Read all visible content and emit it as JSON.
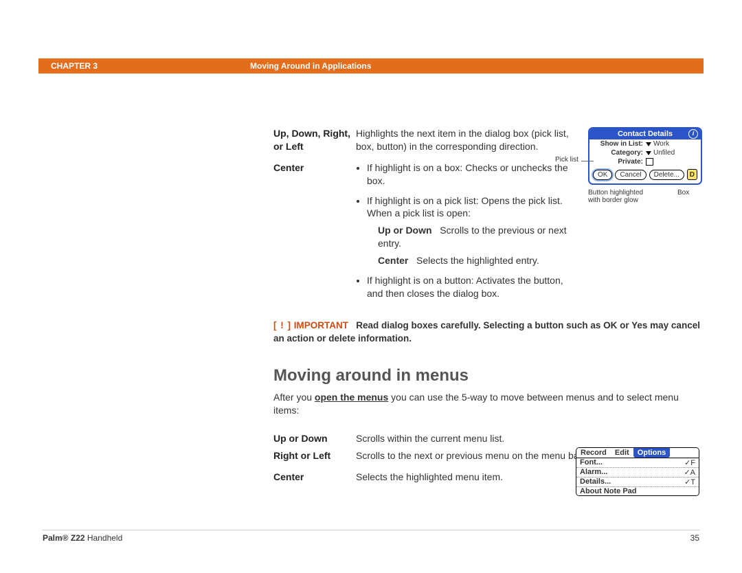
{
  "header": {
    "chapter": "CHAPTER 3",
    "section": "Moving Around in Applications"
  },
  "dialog_table": [
    {
      "label": "Up, Down, Right, or Left",
      "desc": "Highlights the next item in the dialog box (pick list, box, button) in the corresponding direction."
    }
  ],
  "center": {
    "label": "Center",
    "bullet1": "If highlight is on a box: Checks or unchecks the box.",
    "bullet2": "If highlight is on a pick list: Opens the pick list. When a pick list is open:",
    "sub1_label": "Up or Down",
    "sub1_text": "Scrolls to the previous or next entry.",
    "sub2_label": "Center",
    "sub2_text": "Selects the highlighted entry.",
    "bullet3": "If highlight is on a button: Activates the button, and then closes the dialog box."
  },
  "important": {
    "bracket": "[ ! ]",
    "word": "IMPORTANT",
    "text": "Read dialog boxes carefully. Selecting a button such as OK or Yes may cancel an action or delete information."
  },
  "menus": {
    "heading": "Moving around in menus",
    "intro_pre": "After you ",
    "intro_link": "open the menus",
    "intro_post": " you can use the 5-way to move between menus and to select menu items:",
    "rows": [
      {
        "label": "Up or Down",
        "desc": "Scrolls within the current menu list."
      },
      {
        "label": "Right or Left",
        "desc": "Scrolls to the next or previous menu on the menu bar."
      },
      {
        "label": "Center",
        "desc": "Selects the highlighted menu item."
      }
    ]
  },
  "fig1": {
    "title": "Contact Details",
    "show_in_list_k": "Show in List:",
    "show_in_list_v": "Work",
    "category_k": "Category:",
    "category_v": "Unfiled",
    "private_k": "Private:",
    "ok": "OK",
    "cancel": "Cancel",
    "delete": "Delete...",
    "note_glyph": "D",
    "picklist_callout": "Pick list",
    "cap_btn": "Button highlighted with border glow",
    "cap_box": "Box"
  },
  "fig2": {
    "tabs": [
      "Record",
      "Edit",
      "Options"
    ],
    "items": [
      {
        "t": "Font...",
        "s": "✓F"
      },
      {
        "t": "Alarm...",
        "s": "✓A"
      },
      {
        "t": "Details...",
        "s": "✓T"
      },
      {
        "t": "About Note Pad",
        "s": ""
      }
    ]
  },
  "footer": {
    "product_bold": "Palm® Z22",
    "product_rest": " Handheld",
    "page": "35"
  }
}
